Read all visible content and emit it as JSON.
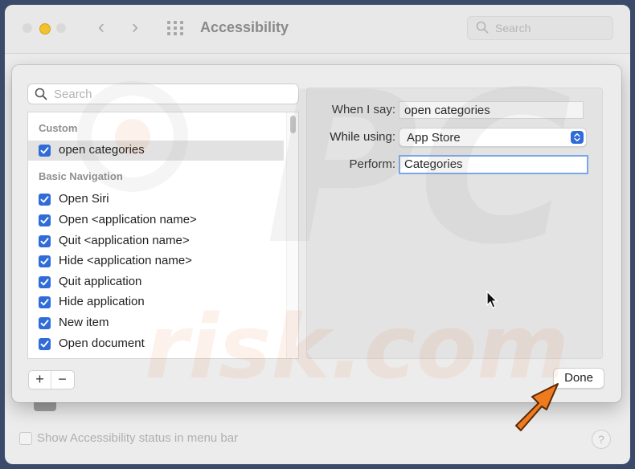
{
  "window": {
    "title": "Accessibility",
    "search_placeholder": "Search"
  },
  "background": {
    "status_checkbox_label": "Show Accessibility status in menu bar",
    "help_label": "?"
  },
  "sheet": {
    "search_placeholder": "Search",
    "sections": [
      {
        "header": "Custom",
        "items": [
          {
            "label": "open categories",
            "checked": true,
            "selected": true
          }
        ]
      },
      {
        "header": "Basic Navigation",
        "items": [
          {
            "label": "Open Siri",
            "checked": true
          },
          {
            "label": "Open <application name>",
            "checked": true
          },
          {
            "label": "Quit <application name>",
            "checked": true
          },
          {
            "label": "Hide <application name>",
            "checked": true
          },
          {
            "label": "Quit application",
            "checked": true
          },
          {
            "label": "Hide application",
            "checked": true
          },
          {
            "label": "New item",
            "checked": true
          },
          {
            "label": "Open document",
            "checked": true
          }
        ]
      }
    ],
    "detail": {
      "when_label": "When I say:",
      "when_value": "open categories",
      "while_label": "While using:",
      "while_value": "App Store",
      "perform_label": "Perform:",
      "perform_value": "Categories"
    },
    "add_label": "+",
    "remove_label": "−",
    "done_label": "Done"
  },
  "icons": {
    "search": "magnifier-icon",
    "checkbox": "checkmark-icon",
    "popup": "up-down-chevron-icon",
    "annotation": "orange-arrow-icon"
  },
  "colors": {
    "accent": "#2f6cd8",
    "focus_ring": "#7aa7e6",
    "annotation_arrow": "#f07a1e",
    "minimize": "#f2c12e"
  },
  "watermark_text": "PC risk.com"
}
